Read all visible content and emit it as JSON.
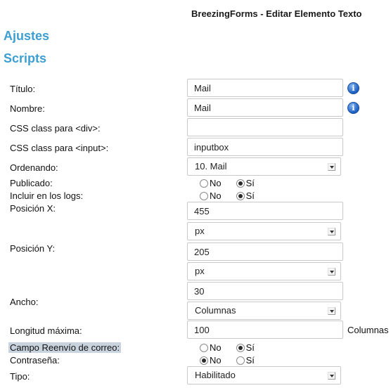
{
  "header": {
    "title": "BreezingForms - Editar Elemento Texto"
  },
  "sections": {
    "ajustes": "Ajustes",
    "scripts": "Scripts"
  },
  "form": {
    "titulo": {
      "label": "Título:",
      "value": "Mail"
    },
    "nombre": {
      "label": "Nombre:",
      "value": "Mail"
    },
    "css_div": {
      "label": "CSS class para <div>:",
      "value": ""
    },
    "css_input": {
      "label": "CSS class para <input>:",
      "value": "inputbox"
    },
    "ordenando": {
      "label": "Ordenando:",
      "value": "10. Mail"
    },
    "publicado": {
      "label": "Publicado:",
      "no": "No",
      "si": "Sí",
      "selected": "si"
    },
    "logs": {
      "label": "Incluir en los logs:",
      "no": "No",
      "si": "Sí",
      "selected": "si"
    },
    "pos_x": {
      "label": "Posición X:",
      "value": "455",
      "unit": "px"
    },
    "pos_y": {
      "label": "Posición Y:",
      "value": "205",
      "unit": "px"
    },
    "ancho": {
      "label": "Ancho:",
      "value": "30",
      "unit": "Columnas"
    },
    "longitud": {
      "label": "Longitud máxima:",
      "value": "100",
      "suffix": "Columnas"
    },
    "reenvio": {
      "label": "Campo Reenvío de correo:",
      "no": "No",
      "si": "Sí",
      "selected": "si"
    },
    "contrasena": {
      "label": "Contraseña:",
      "no": "No",
      "si": "Sí",
      "selected": "no"
    },
    "tipo": {
      "label": "Tipo:",
      "value": "Habilitado"
    }
  },
  "icons": {
    "info": "info-icon",
    "info_glyph": "i",
    "select_arrow": "chevron-down-icon"
  },
  "colors": {
    "section_title": "#3d9fd1",
    "info_icon": "#1c5fc2",
    "label_highlight": "#c9d3de"
  }
}
